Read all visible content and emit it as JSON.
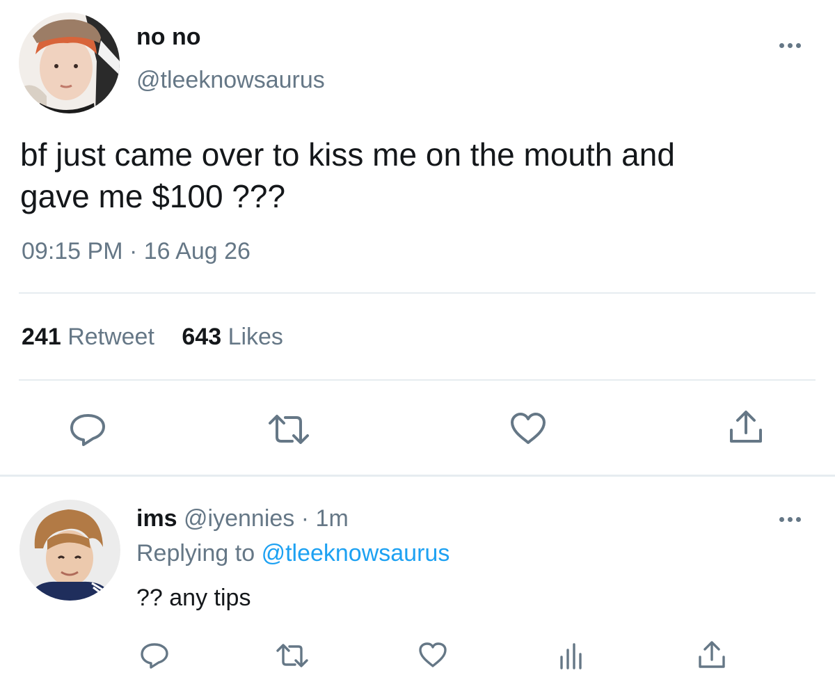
{
  "tweet": {
    "display_name": "no no",
    "handle": "@tleeknowsaurus",
    "text_line1": "bf just came over to kiss me on the mouth and",
    "text_line2": "gave me $100 ???",
    "time": "09:15 PM",
    "separator": "·",
    "date": "16 Aug 26",
    "retweet_count": "241",
    "retweet_label": "Retweet",
    "likes_count": "643",
    "likes_label": "Likes",
    "actions": [
      "reply-icon",
      "retweet-icon",
      "like-icon",
      "share-icon"
    ]
  },
  "reply": {
    "display_name": "ims",
    "handle": "@iyennies",
    "separator": "·",
    "age": "1m",
    "replying_prefix": "Replying to",
    "replying_handle": "@tleeknowsaurus",
    "text": "?? any tips",
    "actions": [
      "reply-icon",
      "retweet-icon",
      "like-icon",
      "analytics-icon",
      "share-icon"
    ]
  },
  "colors": {
    "text": "#14171a",
    "secondary": "#657786",
    "accent": "#1da1f2",
    "divider": "#e6ecf0"
  }
}
